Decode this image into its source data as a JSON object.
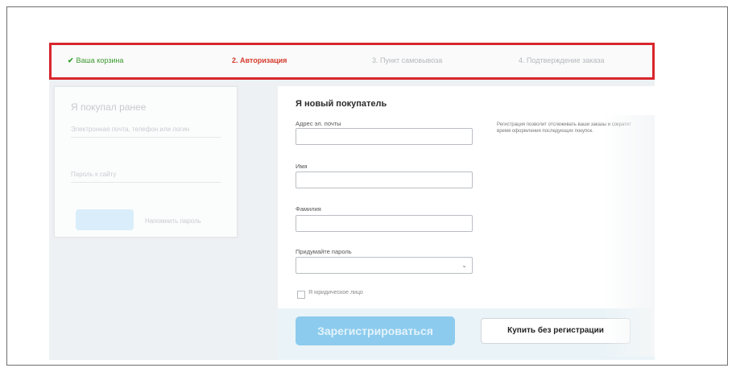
{
  "steps": [
    {
      "label": "Ваша корзина",
      "state": "done"
    },
    {
      "label": "2. Авторизация",
      "state": "active"
    },
    {
      "label": "3. Пункт самовывоза",
      "state": "pending"
    },
    {
      "label": "4. Подтверждение заказа",
      "state": "pending"
    }
  ],
  "colors": {
    "active": "#d63a2b",
    "done": "#3c9a2f",
    "highlight_border": "#d8262c",
    "primary_button": "#8ccbed"
  },
  "login": {
    "title": "Я покупал ранее",
    "login_placeholder": "Электронная почта, телефон или логин",
    "password_placeholder": "Пароль к сайту",
    "remind_link": "Напомнить пароль"
  },
  "register": {
    "title": "Я новый покупатель",
    "email_label": "Адрес эл. почты",
    "name_label": "Имя",
    "surname_label": "Фамилия",
    "password_label": "Придумайте пароль",
    "hint": "Регистрация позволит отслеживать ваши заказы и сократит время оформления последующих покупок.",
    "legal_checkbox": "Я юридическое лицо",
    "submit": "Зарегистрироваться",
    "buy_without": "Купить без регистрации"
  }
}
